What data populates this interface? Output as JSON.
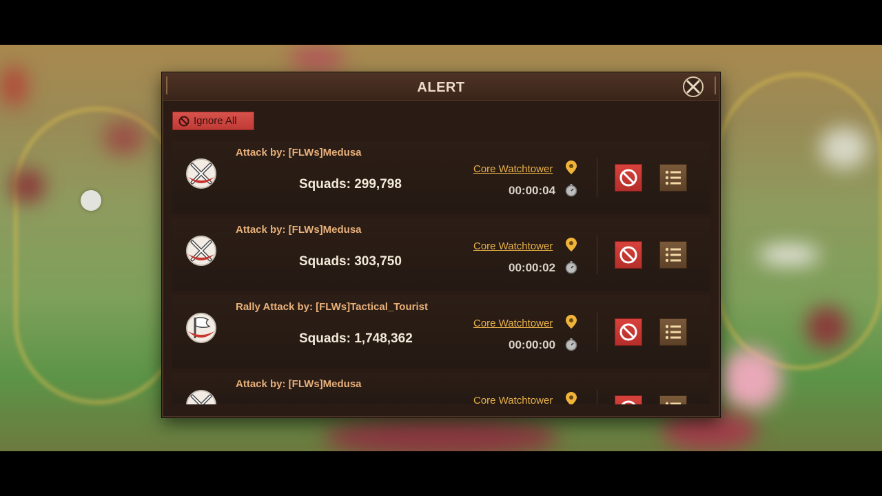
{
  "dialog": {
    "title": "ALERT",
    "ignore_all_label": "Ignore All"
  },
  "alerts": [
    {
      "type_icon": "crossed-swords-icon",
      "attacker": "Attack by: [FLWs]Medusa",
      "squads": "Squads: 299,798",
      "target": "Core Watchtower",
      "timer": "00:00:04"
    },
    {
      "type_icon": "crossed-swords-icon",
      "attacker": "Attack by: [FLWs]Medusa",
      "squads": "Squads: 303,750",
      "target": "Core Watchtower",
      "timer": "00:00:02"
    },
    {
      "type_icon": "rally-flag-icon",
      "attacker": "Rally Attack by: [FLWs]Tactical_Tourist",
      "squads": "Squads: 1,748,362",
      "target": "Core Watchtower",
      "timer": "00:00:00"
    },
    {
      "type_icon": "crossed-swords-icon",
      "attacker": "Attack by: [FLWs]Medusa",
      "squads": "",
      "target": "Core Watchtower",
      "timer": ""
    }
  ],
  "colors": {
    "dialog_bg": "#2a1b14",
    "attacker_text": "#e8b07a",
    "target_link": "#eab24a",
    "ignore_red": "#d8423c",
    "details_brown": "#7a5a3a"
  }
}
